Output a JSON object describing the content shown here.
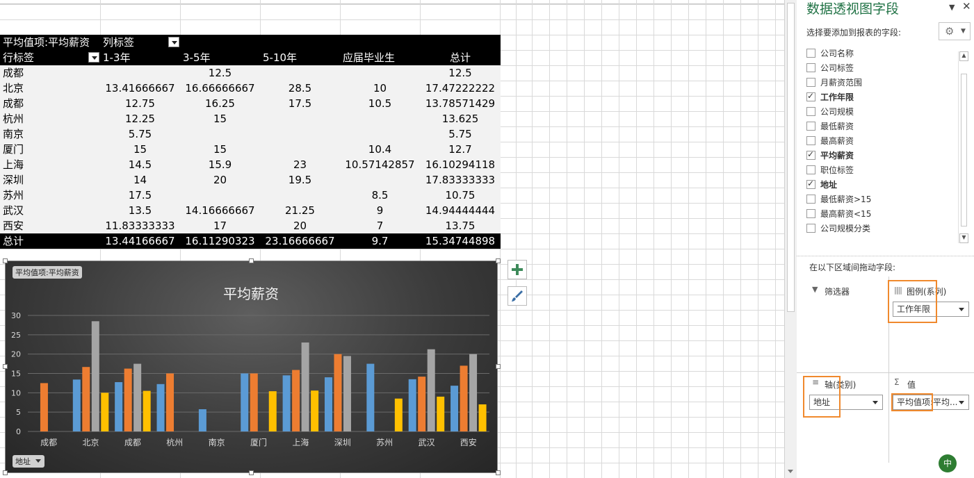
{
  "pivot": {
    "header_value_label": "平均值项:平均薪资",
    "col_label_title": "列标签",
    "row_label_title": "行标签",
    "columns": [
      "1-3年",
      "3-5年",
      "5-10年",
      "应届毕业生",
      "总计"
    ],
    "rows": [
      {
        "name": " 成都",
        "cells": [
          "",
          "12.5",
          "",
          "",
          "12.5"
        ]
      },
      {
        "name": "北京",
        "cells": [
          "13.41666667",
          "16.66666667",
          "28.5",
          "10",
          "17.47222222"
        ]
      },
      {
        "name": "成都",
        "cells": [
          "12.75",
          "16.25",
          "17.5",
          "10.5",
          "13.78571429"
        ]
      },
      {
        "name": "杭州",
        "cells": [
          "12.25",
          "15",
          "",
          "",
          "13.625"
        ]
      },
      {
        "name": "南京",
        "cells": [
          "5.75",
          "",
          "",
          "",
          "5.75"
        ]
      },
      {
        "name": "厦门",
        "cells": [
          "15",
          "15",
          "",
          "10.4",
          "12.7"
        ]
      },
      {
        "name": "上海",
        "cells": [
          "14.5",
          "15.9",
          "23",
          "10.57142857",
          "16.10294118"
        ]
      },
      {
        "name": "深圳",
        "cells": [
          "14",
          "20",
          "19.5",
          "",
          "17.83333333"
        ]
      },
      {
        "name": "苏州",
        "cells": [
          "17.5",
          "",
          "",
          "8.5",
          "10.75"
        ]
      },
      {
        "name": "武汉",
        "cells": [
          "13.5",
          "14.16666667",
          "21.25",
          "9",
          "14.94444444"
        ]
      },
      {
        "name": "西安",
        "cells": [
          "11.83333333",
          "17",
          "20",
          "7",
          "13.75"
        ]
      }
    ],
    "total": {
      "name": "总计",
      "cells": [
        "13.44166667",
        "16.11290323",
        "23.16666667",
        "9.7",
        "15.34744898"
      ]
    }
  },
  "chart_data": {
    "type": "bar",
    "title": "平均薪资",
    "value_field_button": "平均值项:平均薪资",
    "axis_field_button": "地址",
    "categories": [
      " 成都",
      "北京",
      "成都",
      "杭州",
      "南京",
      "厦门",
      "上海",
      "深圳",
      "苏州",
      "武汉",
      "西安"
    ],
    "category_labels": [
      "成都",
      "北京",
      "成都",
      "杭州",
      "南京",
      "厦门",
      "上海",
      "深圳",
      "苏州",
      "武汉",
      "西安"
    ],
    "series": [
      {
        "name": "1-3年",
        "color": "#5b9bd5",
        "values": [
          null,
          13.42,
          12.75,
          12.25,
          5.75,
          15,
          14.5,
          14,
          17.5,
          13.5,
          11.83
        ]
      },
      {
        "name": "3-5年",
        "color": "#ed7d31",
        "values": [
          12.5,
          16.67,
          16.25,
          15,
          null,
          15,
          15.9,
          20,
          null,
          14.17,
          17
        ]
      },
      {
        "name": "5-10年",
        "color": "#a5a5a5",
        "values": [
          null,
          28.5,
          17.5,
          null,
          null,
          null,
          23,
          19.5,
          null,
          21.25,
          20
        ]
      },
      {
        "name": "应届毕业生",
        "color": "#ffc000",
        "values": [
          null,
          10,
          10.5,
          null,
          null,
          10.4,
          10.57,
          null,
          8.5,
          9,
          7
        ]
      }
    ],
    "yticks": [
      "0",
      "5",
      "10",
      "15",
      "20",
      "25",
      "30"
    ],
    "ylim": [
      0,
      30
    ],
    "grid": true
  },
  "panel": {
    "title": "数据透视图字段",
    "subtitle": "选择要添加到报表的字段:",
    "fields": [
      {
        "label": "公司名称",
        "checked": false
      },
      {
        "label": "公司标签",
        "checked": false
      },
      {
        "label": "月薪资范围",
        "checked": false
      },
      {
        "label": "工作年限",
        "checked": true
      },
      {
        "label": "公司规模",
        "checked": false
      },
      {
        "label": "最低薪资",
        "checked": false
      },
      {
        "label": "最高薪资",
        "checked": false
      },
      {
        "label": "平均薪资",
        "checked": true
      },
      {
        "label": "职位标签",
        "checked": false
      },
      {
        "label": "地址",
        "checked": true
      },
      {
        "label": "最低薪资>15",
        "checked": false
      },
      {
        "label": "最高薪资<15",
        "checked": false
      },
      {
        "label": "公司规模分类",
        "checked": false
      }
    ],
    "drag_hint": "在以下区域间拖动字段:",
    "areas": {
      "filter_label": "筛选器",
      "legend_label": "图例(系列)",
      "legend_value": "工作年限",
      "axis_label": "轴(类别)",
      "axis_value": "地址",
      "values_label": "值",
      "values_value": "平均值项:平均..."
    },
    "ime_badge": "中"
  }
}
